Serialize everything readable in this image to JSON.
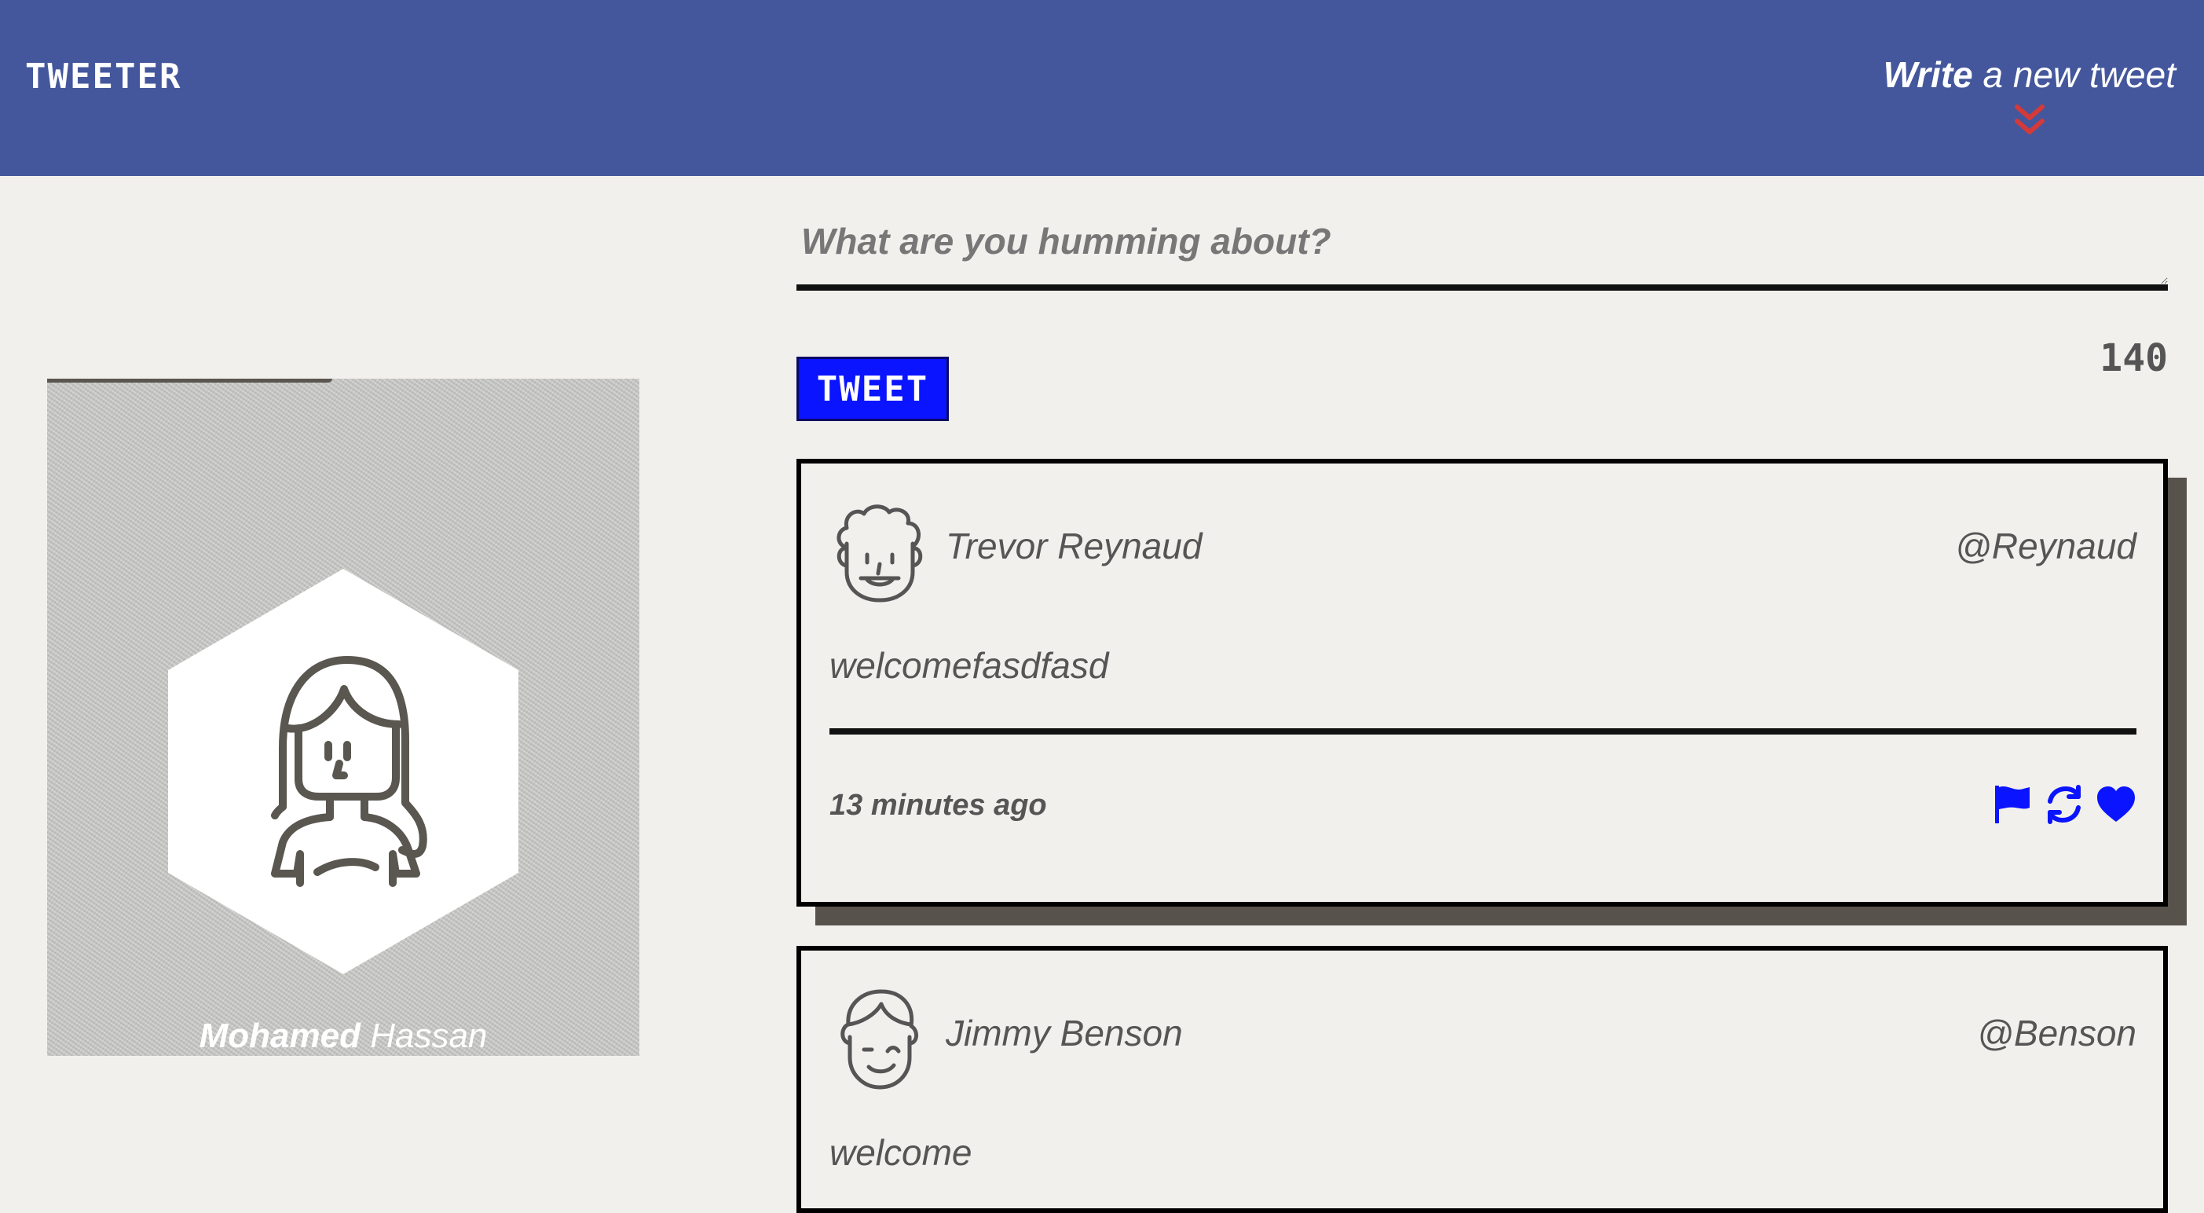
{
  "nav": {
    "brand": "TWEETER",
    "compose_toggle": {
      "bold": "Write",
      "rest": " a new tweet",
      "arrow_icon": "double-chevron-down-icon",
      "arrow_color": "#d43a3a"
    }
  },
  "profile": {
    "first_name": "Mohamed",
    "last_name": " Hassan",
    "avatar_icon": "woman-avatar-icon"
  },
  "composer": {
    "placeholder": "What are you humming about?",
    "value": "",
    "button_label": "TWEET",
    "counter": "140"
  },
  "tweets": [
    {
      "name": "Trevor Reynaud",
      "handle": "@Reynaud",
      "content": "welcomefasdfasd",
      "time": "13 minutes ago",
      "avatar_icon": "curly-hair-man-avatar-icon",
      "actions": [
        "flag-icon",
        "retweet-icon",
        "heart-icon"
      ]
    },
    {
      "name": "Jimmy Benson",
      "handle": "@Benson",
      "content": "welcome",
      "avatar_icon": "winking-man-avatar-icon"
    }
  ],
  "colors": {
    "header": "#44579c",
    "background": "#f2f0ec",
    "accent": "#0a14ff",
    "text": "#555555"
  }
}
